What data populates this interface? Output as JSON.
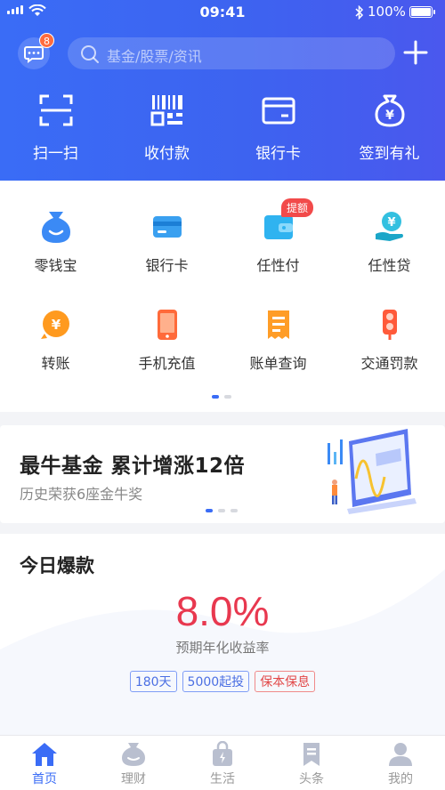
{
  "status_bar": {
    "time": "09:41",
    "battery": "100%"
  },
  "header": {
    "message_badge": "8",
    "search_placeholder": "基金/股票/资讯",
    "quick_actions": [
      {
        "label": "扫一扫",
        "icon": "scan-icon"
      },
      {
        "label": "收付款",
        "icon": "barcode-icon"
      },
      {
        "label": "银行卡",
        "icon": "bank-card-icon"
      },
      {
        "label": "签到有礼",
        "icon": "money-bag-icon"
      }
    ]
  },
  "services": {
    "items": [
      {
        "label": "零钱宝",
        "icon": "money-bag-icon"
      },
      {
        "label": "银行卡",
        "icon": "bank-card-icon"
      },
      {
        "label": "任性付",
        "icon": "wallet-icon",
        "tag": "提额"
      },
      {
        "label": "任性贷",
        "icon": "loan-hand-icon"
      },
      {
        "label": "转账",
        "icon": "transfer-icon"
      },
      {
        "label": "手机充值",
        "icon": "phone-icon"
      },
      {
        "label": "账单查询",
        "icon": "bill-icon"
      },
      {
        "label": "交通罚款",
        "icon": "traffic-light-icon"
      }
    ]
  },
  "banner": {
    "title": "最牛基金  累计增涨12倍",
    "subtitle": "历史荣获6座金牛奖"
  },
  "hot_product": {
    "title": "今日爆款",
    "rate": "8.0%",
    "rate_label": "预期年化收益率",
    "tags": [
      "180天",
      "5000起投",
      "保本保息"
    ]
  },
  "tabbar": {
    "items": [
      {
        "label": "首页",
        "active": true
      },
      {
        "label": "理财",
        "active": false
      },
      {
        "label": "生活",
        "active": false
      },
      {
        "label": "头条",
        "active": false
      },
      {
        "label": "我的",
        "active": false
      }
    ]
  },
  "colors": {
    "primary": "#3a6cf6",
    "accent_red": "#e8384f"
  }
}
